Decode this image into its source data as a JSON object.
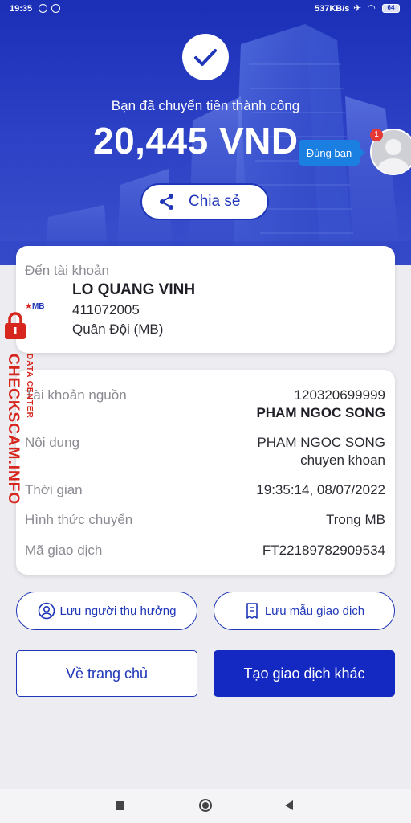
{
  "status_bar": {
    "time": "19:35",
    "network_speed": "537KB/s",
    "battery": "64"
  },
  "hero": {
    "success_text": "Bạn đã chuyển tiền thành công",
    "amount": "20,445 VND",
    "share_label": "Chia sẻ",
    "tooltip_text": "Đúng bạn",
    "notification_count": "1"
  },
  "recipient": {
    "heading": "Đến tài khoản",
    "name": "LO QUANG VINH",
    "account_number": "411072005",
    "bank": "Quân Đội (MB)",
    "bank_logo_text": "MB"
  },
  "details": [
    {
      "label": "Tài khoản nguồn",
      "value": "120320699999",
      "value2": "PHAM NGOC SONG"
    },
    {
      "label": "Nội dung",
      "value": "PHAM NGOC SONG",
      "value2": "chuyen khoan"
    },
    {
      "label": "Thời gian",
      "value": "19:35:14, 08/07/2022"
    },
    {
      "label": "Hình thức chuyển",
      "value": "Trong MB"
    },
    {
      "label": "Mã giao dịch",
      "value": "FT22189782909534"
    }
  ],
  "actions": {
    "save_beneficiary": "Lưu người thụ hưởng",
    "save_template": "Lưu mẫu giao dịch",
    "home": "Về trang chủ",
    "new_transaction": "Tạo giao dịch khác"
  },
  "watermark": {
    "main": "CHECKSCAM.INFO",
    "sub": "DATA CENTER"
  },
  "colors": {
    "primary": "#1428c2",
    "hero": "#2a3fc4",
    "watermark": "#d7261e"
  },
  "icons": [
    "check-icon",
    "share-icon",
    "user-circle-icon",
    "receipt-icon",
    "lock-icon",
    "square-nav-icon",
    "circle-nav-icon",
    "back-nav-icon"
  ]
}
